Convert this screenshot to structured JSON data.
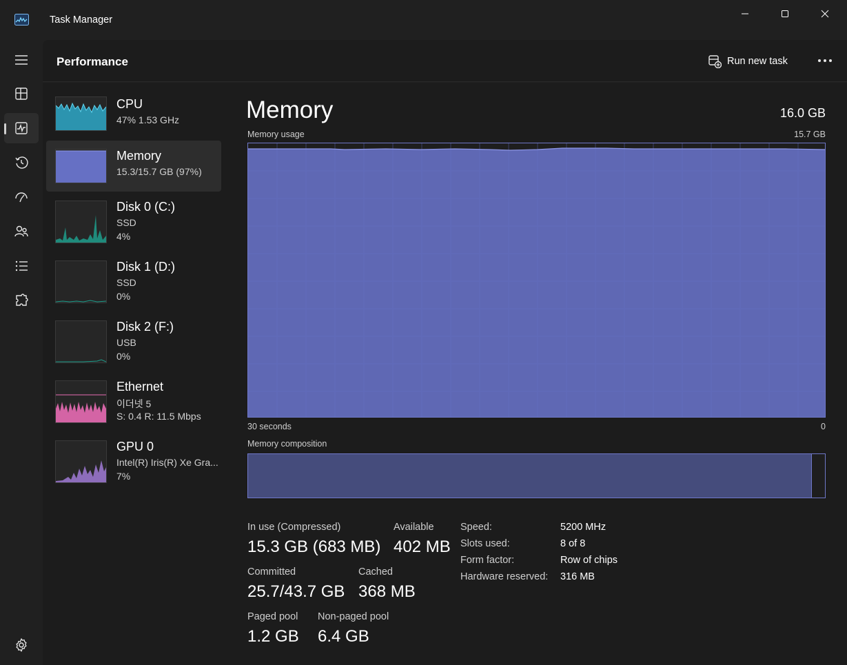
{
  "window": {
    "title": "Task Manager"
  },
  "header": {
    "title": "Performance",
    "run_new_task": "Run new task"
  },
  "nav": {
    "items": [
      "menu",
      "processes",
      "performance",
      "app-history",
      "startup-apps",
      "users",
      "details",
      "services"
    ],
    "active": "performance"
  },
  "sidebar": {
    "items": [
      {
        "name": "CPU",
        "line1": "47%  1.53 GHz",
        "line2": ""
      },
      {
        "name": "Memory",
        "line1": "15.3/15.7 GB (97%)",
        "line2": ""
      },
      {
        "name": "Disk 0 (C:)",
        "line1": "SSD",
        "line2": "4%"
      },
      {
        "name": "Disk 1 (D:)",
        "line1": "SSD",
        "line2": "0%"
      },
      {
        "name": "Disk 2 (F:)",
        "line1": "USB",
        "line2": "0%"
      },
      {
        "name": "Ethernet",
        "line1": "이더넷 5",
        "line2": "S: 0.4  R: 11.5 Mbps"
      },
      {
        "name": "GPU 0",
        "line1": "Intel(R) Iris(R) Xe Gra...",
        "line2": "7%"
      }
    ]
  },
  "main": {
    "title": "Memory",
    "total": "16.0 GB",
    "usage_label": "Memory usage",
    "usage_max": "15.7 GB",
    "axis_left": "30 seconds",
    "axis_right": "0",
    "composition_label": "Memory composition",
    "composition_in_use_fraction": 0.977,
    "stats": {
      "in_use_label": "In use (Compressed)",
      "in_use_value": "15.3 GB (683 MB)",
      "available_label": "Available",
      "available_value": "402 MB",
      "committed_label": "Committed",
      "committed_value": "25.7/43.7 GB",
      "cached_label": "Cached",
      "cached_value": "368 MB",
      "paged_label": "Paged pool",
      "paged_value": "1.2 GB",
      "nonpaged_label": "Non-paged pool",
      "nonpaged_value": "6.4 GB"
    },
    "details": [
      {
        "label": "Speed:",
        "value": "5200 MHz"
      },
      {
        "label": "Slots used:",
        "value": "8 of 8"
      },
      {
        "label": "Form factor:",
        "value": "Row of chips"
      },
      {
        "label": "Hardware reserved:",
        "value": "316 MB"
      }
    ]
  },
  "colors": {
    "memory": "#6670c4",
    "cpu": "#2ea8c8",
    "disk": "#1e9e8c",
    "ethernet": "#e86cb4",
    "gpu": "#a07ad6"
  }
}
